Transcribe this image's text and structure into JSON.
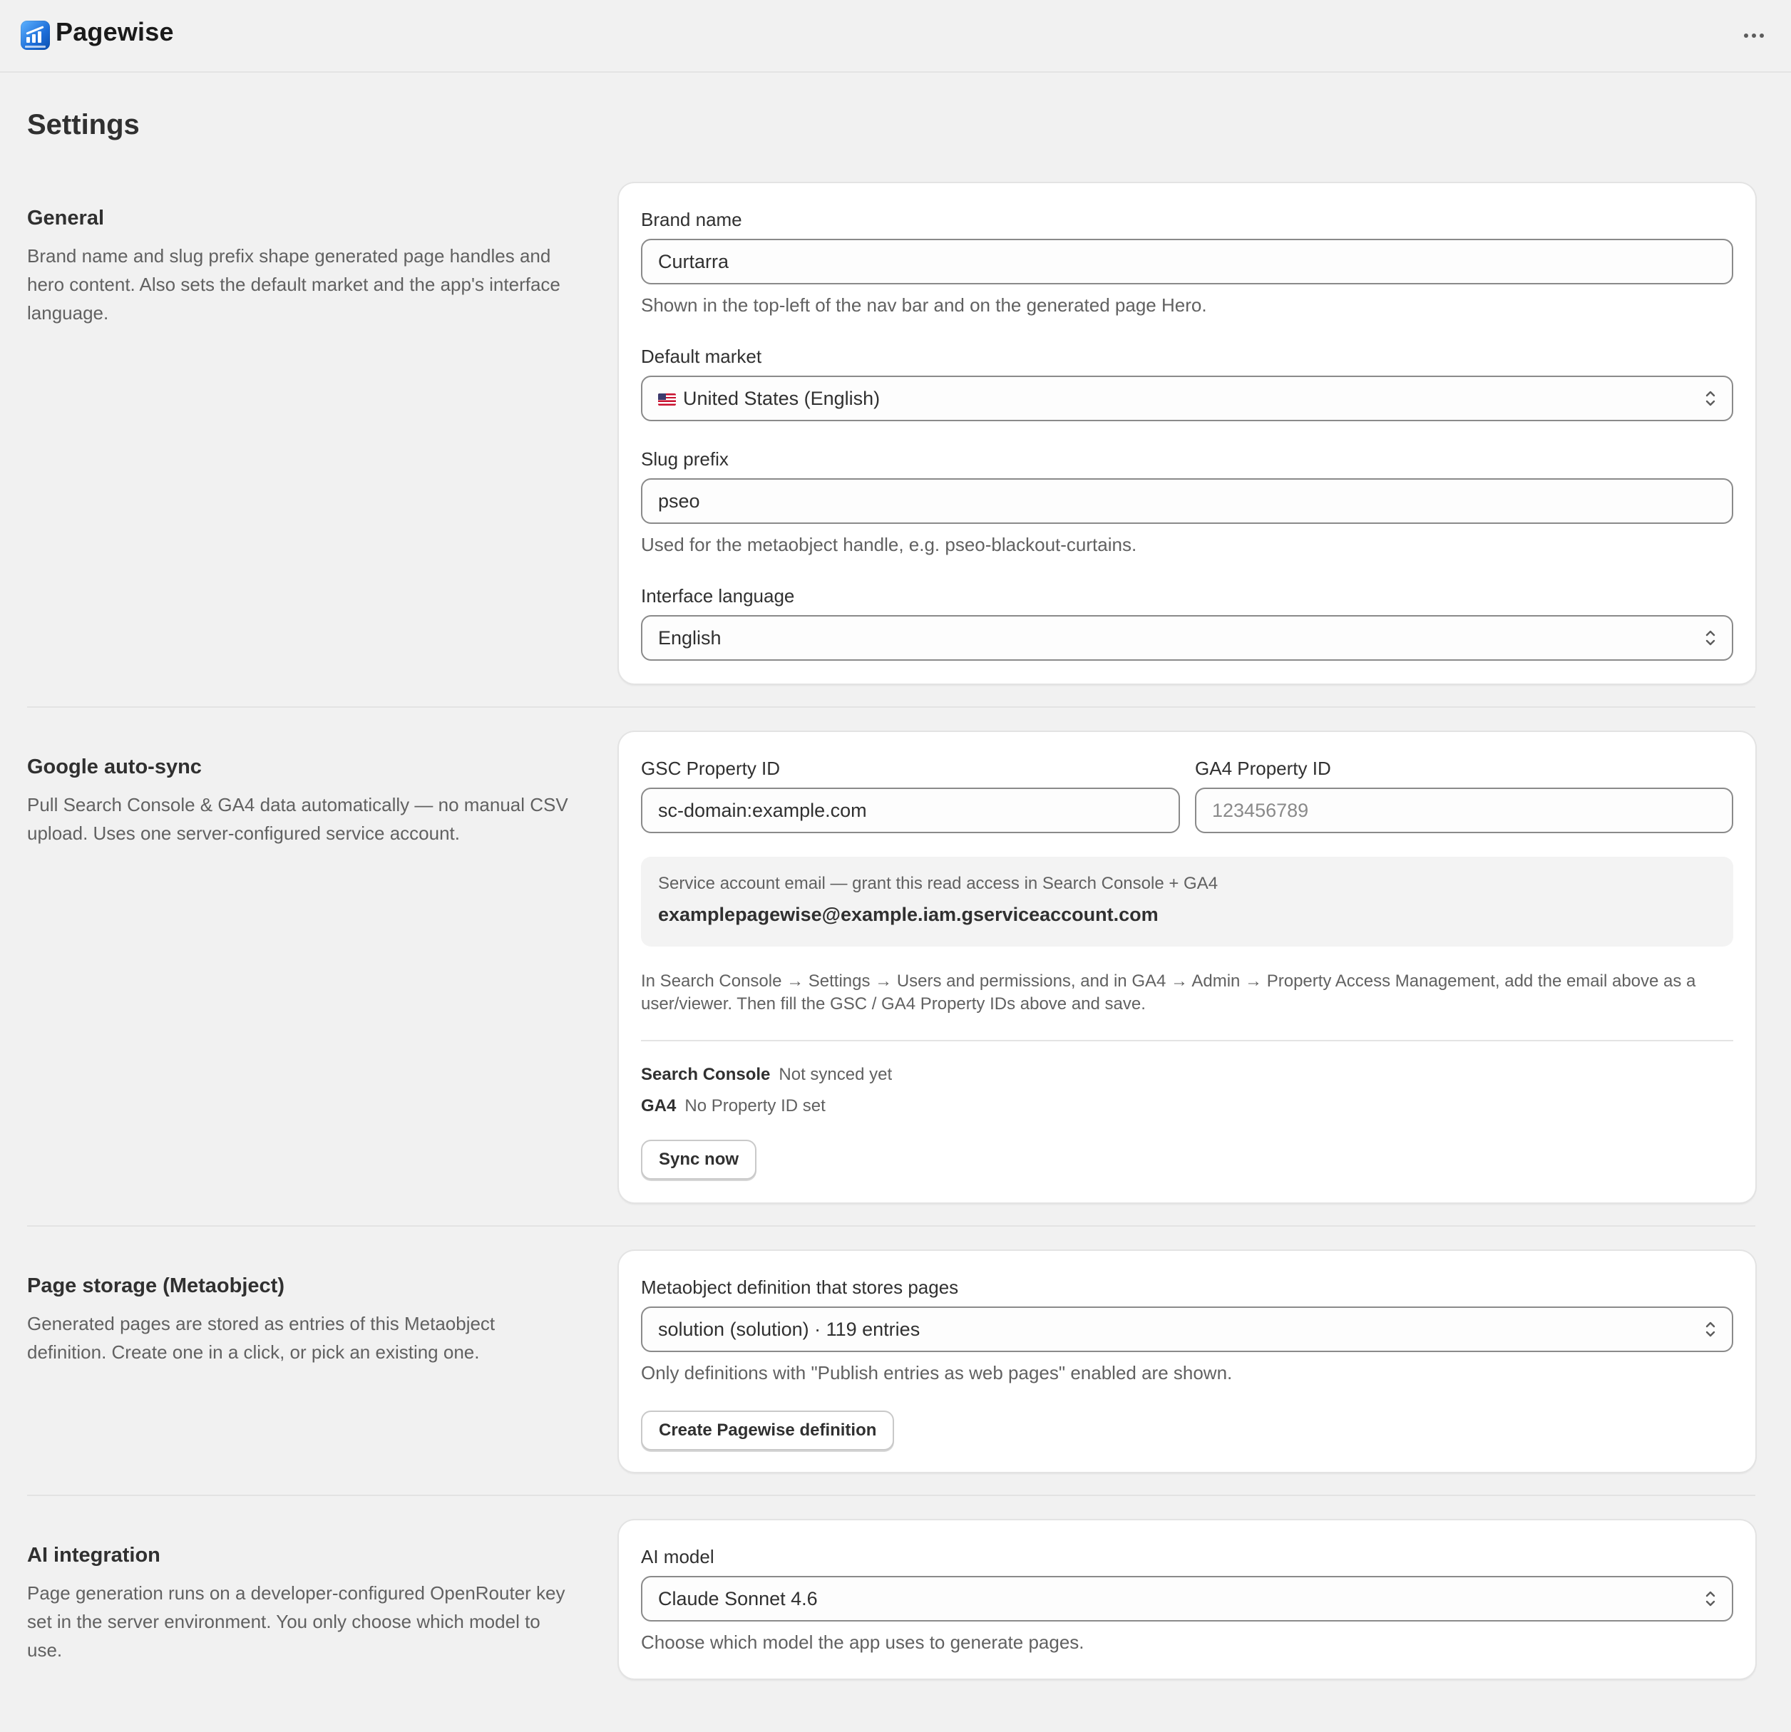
{
  "app": {
    "name": "Pagewise"
  },
  "page": {
    "title": "Settings"
  },
  "general": {
    "title": "General",
    "description": "Brand name and slug prefix shape generated page handles and hero content. Also sets the default market and the app's interface language.",
    "brand_name_label": "Brand name",
    "brand_name_value": "Curtarra",
    "brand_name_help": "Shown in the top-left of the nav bar and on the generated page Hero.",
    "default_market_label": "Default market",
    "default_market_value": "United States (English)",
    "slug_prefix_label": "Slug prefix",
    "slug_prefix_value": "pseo",
    "slug_prefix_help": "Used for the metaobject handle, e.g. pseo-blackout-curtains.",
    "interface_language_label": "Interface language",
    "interface_language_value": "English"
  },
  "google": {
    "title": "Google auto-sync",
    "description": "Pull Search Console & GA4 data automatically — no manual CSV upload. Uses one server-configured service account.",
    "gsc_label": "GSC Property ID",
    "gsc_value": "sc-domain:example.com",
    "ga4_label": "GA4 Property ID",
    "ga4_placeholder": "123456789",
    "service_account_caption": "Service account email — grant this read access in Search Console + GA4",
    "service_account_email": "examplepagewise@example.iam.gserviceaccount.com",
    "instructions": "In Search Console → Settings → Users and permissions, and in GA4 → Admin → Property Access Management, add the email above as a user/viewer. Then fill the GSC / GA4 Property IDs above and save.",
    "status": [
      {
        "name": "Search Console",
        "value": "Not synced yet"
      },
      {
        "name": "GA4",
        "value": "No Property ID set"
      }
    ],
    "sync_button": "Sync now"
  },
  "storage": {
    "title": "Page storage (Metaobject)",
    "description": "Generated pages are stored as entries of this Metaobject definition. Create one in a click, or pick an existing one.",
    "definition_label": "Metaobject definition that stores pages",
    "definition_value": "solution (solution) · 119 entries",
    "definition_help": "Only definitions with \"Publish entries as web pages\" enabled are shown.",
    "create_button": "Create Pagewise definition"
  },
  "ai": {
    "title": "AI integration",
    "description": "Page generation runs on a developer-configured OpenRouter key set in the server environment. You only choose which model to use.",
    "model_label": "AI model",
    "model_value": "Claude Sonnet 4.6",
    "model_help": "Choose which model the app uses to generate pages."
  },
  "icons": {
    "logo": "pagewise-logo-icon",
    "more": "more-horizontal-icon",
    "select": "select-chevrons-icon",
    "flag": "us-flag-icon"
  }
}
